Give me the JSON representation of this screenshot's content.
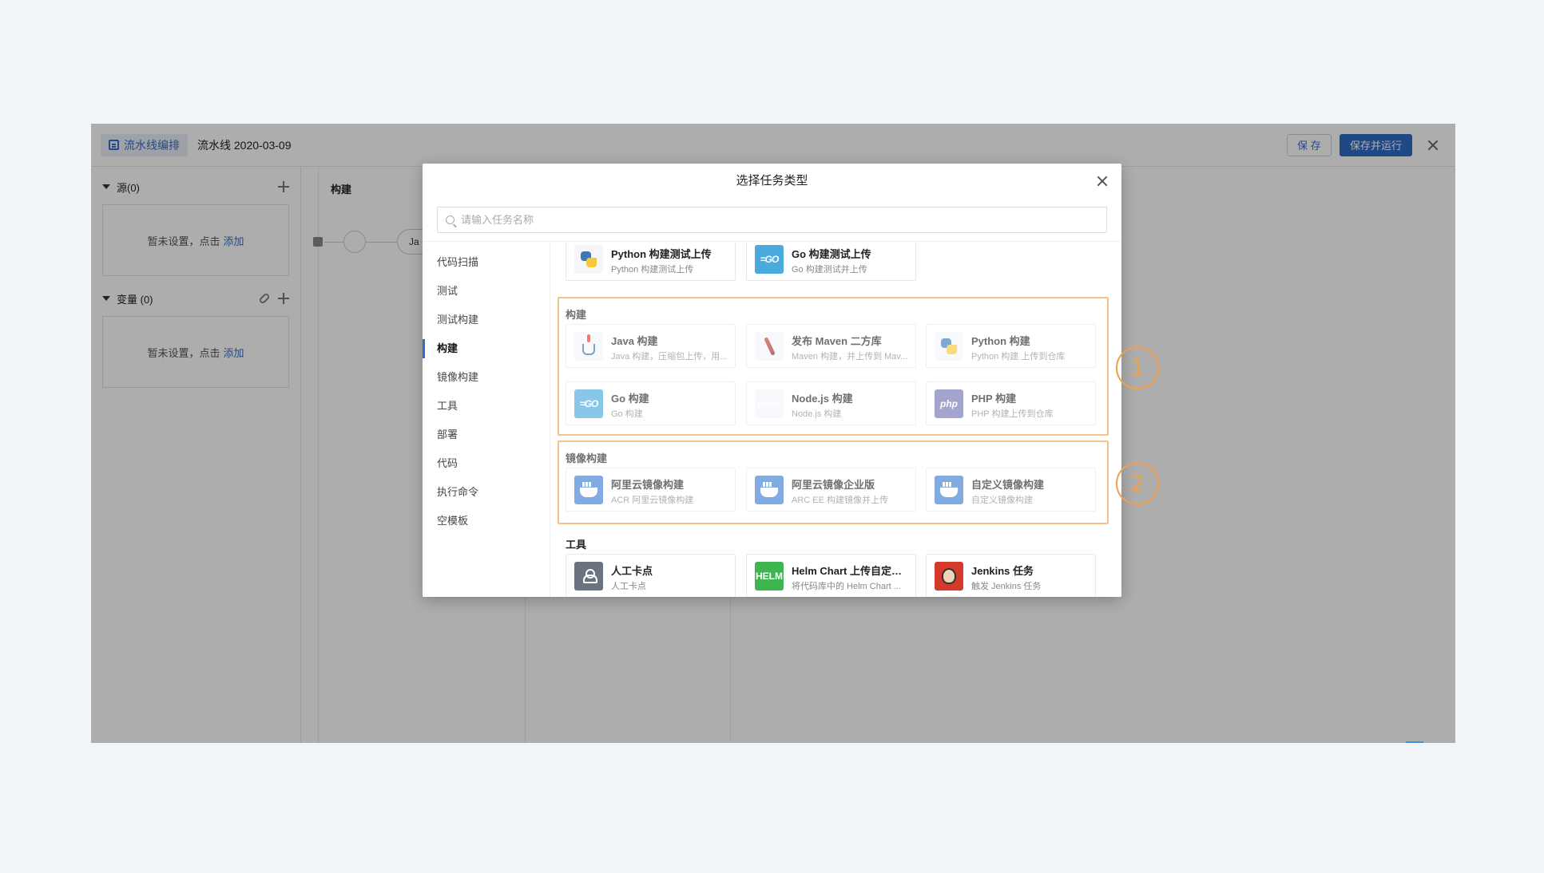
{
  "topbar": {
    "mode_tag": "流水线编排",
    "pipeline_name": "流水线 2020-03-09",
    "save_label": "保 存",
    "save_run_label": "保存并运行"
  },
  "left": {
    "sources": {
      "title": "源(0)",
      "empty_text": "暂未设置，点击",
      "add_link": "添加"
    },
    "variables": {
      "title": "变量 (0)",
      "empty_text": "暂未设置，点击",
      "add_link": "添加"
    }
  },
  "canvas": {
    "stage_title": "构建",
    "stage_chip": "Ja"
  },
  "modal": {
    "title": "选择任务类型",
    "search_placeholder": "请输入任务名称",
    "categories": [
      "代码扫描",
      "测试",
      "测试构建",
      "构建",
      "镜像构建",
      "工具",
      "部署",
      "代码",
      "执行命令",
      "空模板"
    ],
    "active_category": "构建",
    "prev_group": {
      "cards": [
        {
          "icon": "python-icon",
          "title": "Python 构建测试上传",
          "subtitle": "Python 构建测试上传"
        },
        {
          "icon": "go-icon",
          "title": "Go 构建测试上传",
          "subtitle": "Go 构建测试并上传"
        }
      ]
    },
    "build_group": {
      "title": "构建",
      "cards": [
        {
          "icon": "java-icon",
          "title": "Java 构建",
          "subtitle": "Java 构建，压缩包上传，用..."
        },
        {
          "icon": "maven-icon",
          "title": "发布 Maven 二方库",
          "subtitle": "Maven 构建，并上传到 Mav..."
        },
        {
          "icon": "python-icon",
          "title": "Python 构建",
          "subtitle": "Python 构建 上传到仓库"
        },
        {
          "icon": "go-icon",
          "title": "Go 构建",
          "subtitle": "Go 构建"
        },
        {
          "icon": "nodejs-icon",
          "title": "Node.js 构建",
          "subtitle": "Node.js 构建"
        },
        {
          "icon": "php-icon",
          "title": "PHP 构建",
          "subtitle": "PHP 构建上传到仓库"
        }
      ]
    },
    "image_group": {
      "title": "镜像构建",
      "cards": [
        {
          "icon": "docker-icon",
          "title": "阿里云镜像构建",
          "subtitle": "ACR 阿里云镜像构建"
        },
        {
          "icon": "docker-icon",
          "title": "阿里云镜像企业版",
          "subtitle": "ARC EE 构建镜像并上传"
        },
        {
          "icon": "docker-icon",
          "title": "自定义镜像构建",
          "subtitle": "自定义镜像构建"
        }
      ]
    },
    "tools_group": {
      "title": "工具",
      "cards": [
        {
          "icon": "manual-checkpoint-icon",
          "title": "人工卡点",
          "subtitle": "人工卡点"
        },
        {
          "icon": "helm-icon",
          "title": "Helm Chart 上传自定义...",
          "subtitle": "将代码库中的 Helm Chart ..."
        },
        {
          "icon": "jenkins-icon",
          "title": "Jenkins 任务",
          "subtitle": "触发 Jenkins 任务"
        }
      ]
    }
  },
  "annotations": [
    "1",
    "2"
  ],
  "colors": {
    "primary": "#2f6bc8",
    "highlight": "#f6c28b",
    "marker": "#f0a04b"
  }
}
